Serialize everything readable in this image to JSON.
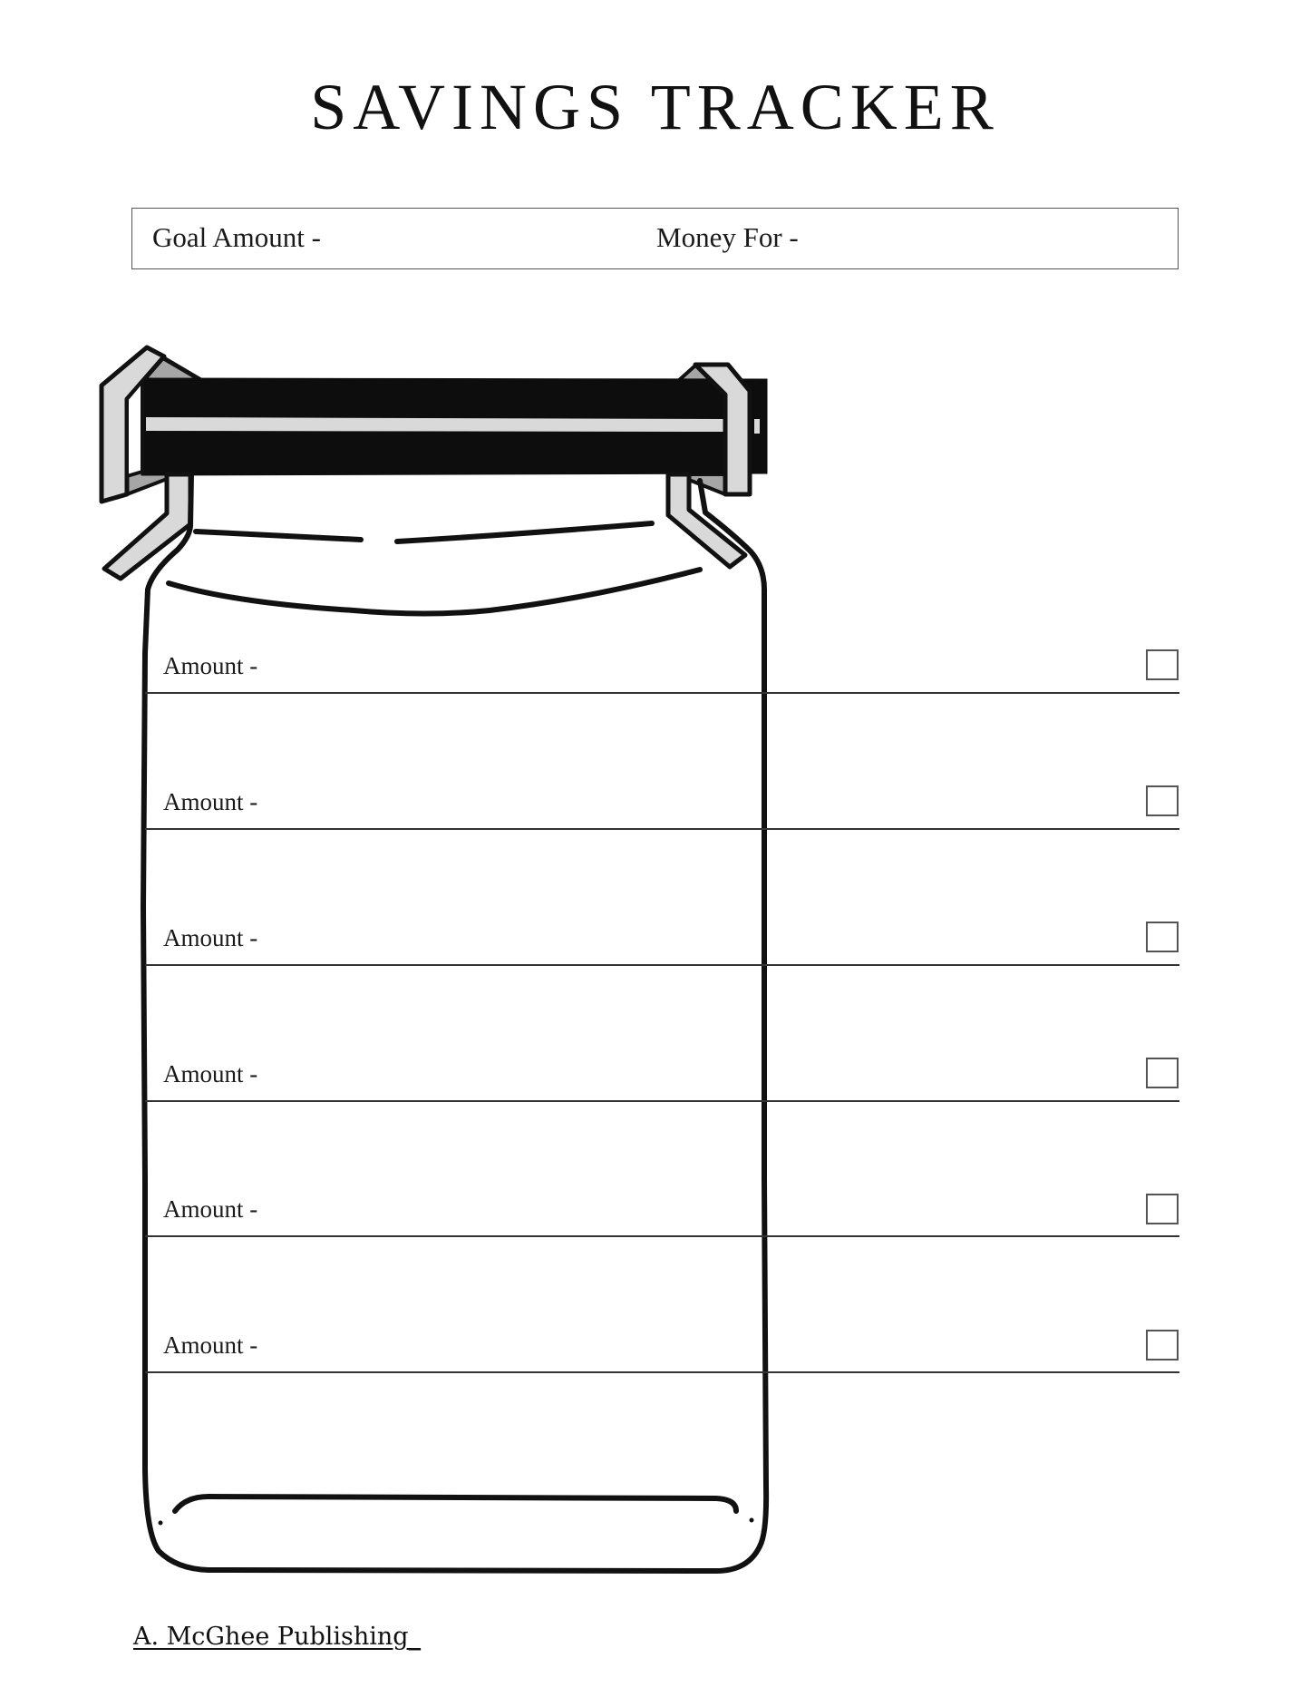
{
  "page": {
    "title": "SAVINGS TRACKER"
  },
  "goal_box": {
    "goal_amount_label": "Goal Amount -",
    "money_for_label": "Money For -"
  },
  "jar_illustration": {
    "icon": "mason-jar-icon",
    "colors": {
      "outline": "#111111",
      "lid": "#0d0d0d",
      "lid_stripe": "#d9d9d9",
      "clip": "#d9d9d9",
      "clip_shadow": "#a6a6a6"
    }
  },
  "entries": [
    {
      "label": "Amount -",
      "checked": false
    },
    {
      "label": "Amount -",
      "checked": false
    },
    {
      "label": "Amount -",
      "checked": false
    },
    {
      "label": "Amount -",
      "checked": false
    },
    {
      "label": "Amount -",
      "checked": false
    },
    {
      "label": "Amount -",
      "checked": false
    }
  ],
  "footer": {
    "publisher": "A. McGhee Publishing_"
  }
}
